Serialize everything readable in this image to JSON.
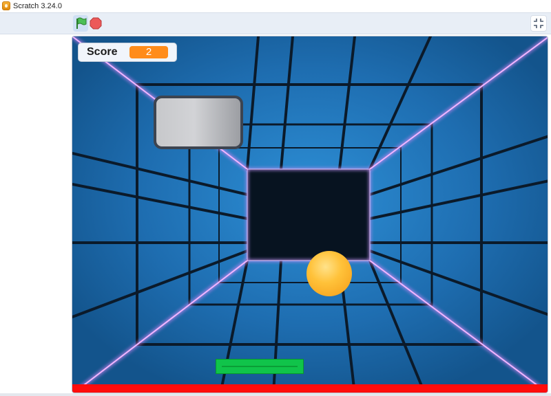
{
  "window": {
    "title": "Scratch 3.24.0"
  },
  "toolbar": {
    "green_flag": "green-flag-icon",
    "stop": "stop-icon",
    "fullscreen": "unfullscreen-icon"
  },
  "game": {
    "score_label": "Score",
    "score_value": "2"
  },
  "colors": {
    "tunnel_blue": "#1a5d9a",
    "tunnel_core": "#071320",
    "neon_edge": "#e38bff",
    "paddle_green": "#10c44a",
    "floor_red": "#ff0c0c",
    "ball_orange": "#ffc23a",
    "score_orange": "#ff8c1a"
  }
}
